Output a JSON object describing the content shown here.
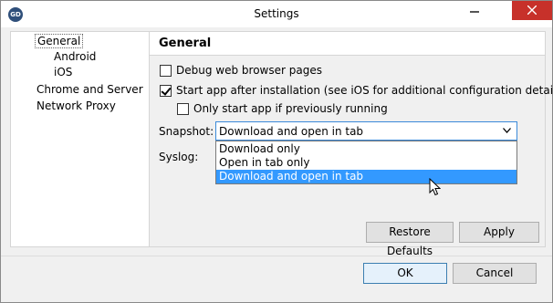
{
  "window": {
    "title": "Settings",
    "app_icon": "GD"
  },
  "tree": {
    "items": [
      {
        "label": "General",
        "selected": true
      },
      {
        "label": "Android"
      },
      {
        "label": "iOS"
      },
      {
        "label": "Chrome and Server"
      },
      {
        "label": "Network Proxy"
      }
    ]
  },
  "panel": {
    "title": "General",
    "debug_label": "Debug web browser pages",
    "debug_checked": false,
    "start_label": "Start app after installation (see iOS for additional configuration details)",
    "start_checked": true,
    "only_start_label": "Only start app if previously running",
    "only_start_checked": false,
    "snapshot_label": "Snapshot:",
    "snapshot_value": "Download and open in tab",
    "snapshot_options": [
      "Download only",
      "Open in tab only",
      "Download and open in tab"
    ],
    "highlighted_option": "Download and open in tab",
    "syslog_label": "Syslog:",
    "restore_defaults": "Restore Defaults",
    "apply": "Apply"
  },
  "footer": {
    "ok": "OK",
    "cancel": "Cancel"
  },
  "colors": {
    "accent": "#3399ff",
    "close": "#c7312a",
    "select_border": "#3b8ad9"
  }
}
